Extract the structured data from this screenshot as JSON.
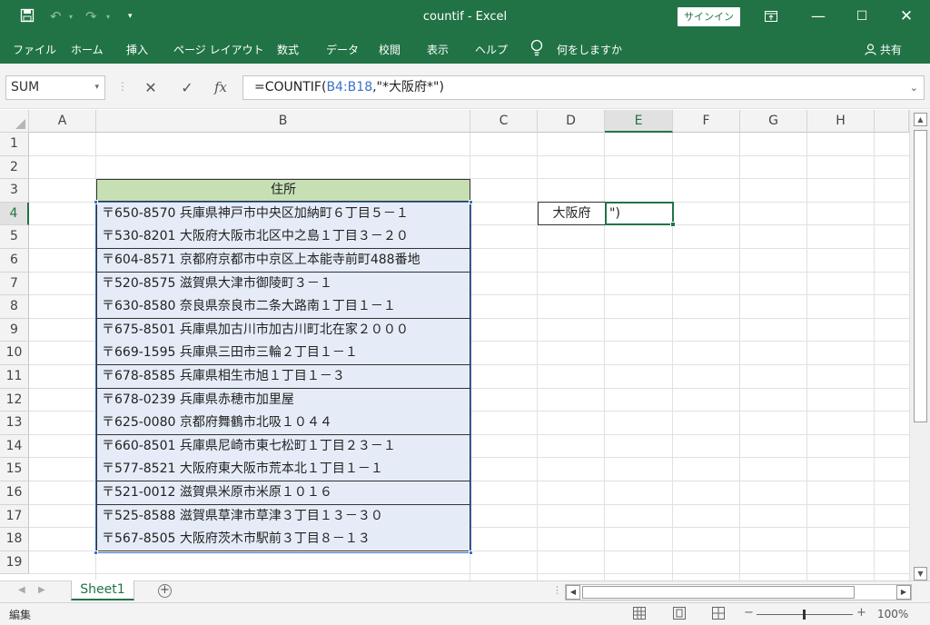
{
  "title_bar": {
    "title": "countif  -  Excel",
    "signin_label": "サインイン"
  },
  "ribbon": {
    "tabs": [
      "ファイル",
      "ホーム",
      "挿入",
      "ページ レイアウト",
      "数式",
      "データ",
      "校閲",
      "表示",
      "ヘルプ"
    ],
    "tell_me": "何をしますか",
    "share": "共有"
  },
  "formula_bar": {
    "name_box": "SUM",
    "fx_label": "fx",
    "formula_prefix": "=COUNTIF(",
    "formula_ref": "B4:B18",
    "formula_suffix": ",\"*大阪府*\")"
  },
  "columns": [
    "A",
    "B",
    "C",
    "D",
    "E",
    "F",
    "G",
    "H"
  ],
  "selected_column": "E",
  "rows": [
    "1",
    "2",
    "3",
    "4",
    "5",
    "6",
    "7",
    "8",
    "9",
    "10",
    "11",
    "12",
    "13",
    "14",
    "15",
    "16",
    "17",
    "18",
    "19"
  ],
  "selected_row": "4",
  "sheet": {
    "header_b3": "住所",
    "addresses": [
      "〒650-8570 兵庫県神戸市中央区加納町６丁目５－１",
      "〒530-8201 大阪府大阪市北区中之島１丁目３－２０",
      "〒604-8571 京都府京都市中京区上本能寺前町488番地",
      "〒520-8575 滋賀県大津市御陵町３－１",
      "〒630-8580 奈良県奈良市二条大路南１丁目１－１",
      "〒675-8501 兵庫県加古川市加古川町北在家２０００",
      "〒669-1595 兵庫県三田市三輪２丁目１－１",
      "〒678-8585 兵庫県相生市旭１丁目１－３",
      "〒678-0239 兵庫県赤穂市加里屋",
      "〒625-0080 京都府舞鶴市北吸１０４４",
      "〒660-8501 兵庫県尼崎市東七松町１丁目２３－１",
      "〒577-8521 大阪府東大阪市荒本北１丁目１－１",
      "〒521-0012 滋賀県米原市米原１０１６",
      "〒525-8588 滋賀県草津市草津３丁目１３－３０",
      "〒567-8505 大阪府茨木市駅前３丁目８－１３"
    ],
    "d4": "大阪府",
    "e4": "\")"
  },
  "sheet_tabs": {
    "active": "Sheet1",
    "add_label": "+"
  },
  "status_bar": {
    "mode": "編集",
    "zoom": "100%"
  },
  "colors": {
    "excel_green": "#217346",
    "header_fill": "#c6e0b4",
    "range_fill": "#e5ecf7",
    "ref_blue": "#3a72c8"
  }
}
